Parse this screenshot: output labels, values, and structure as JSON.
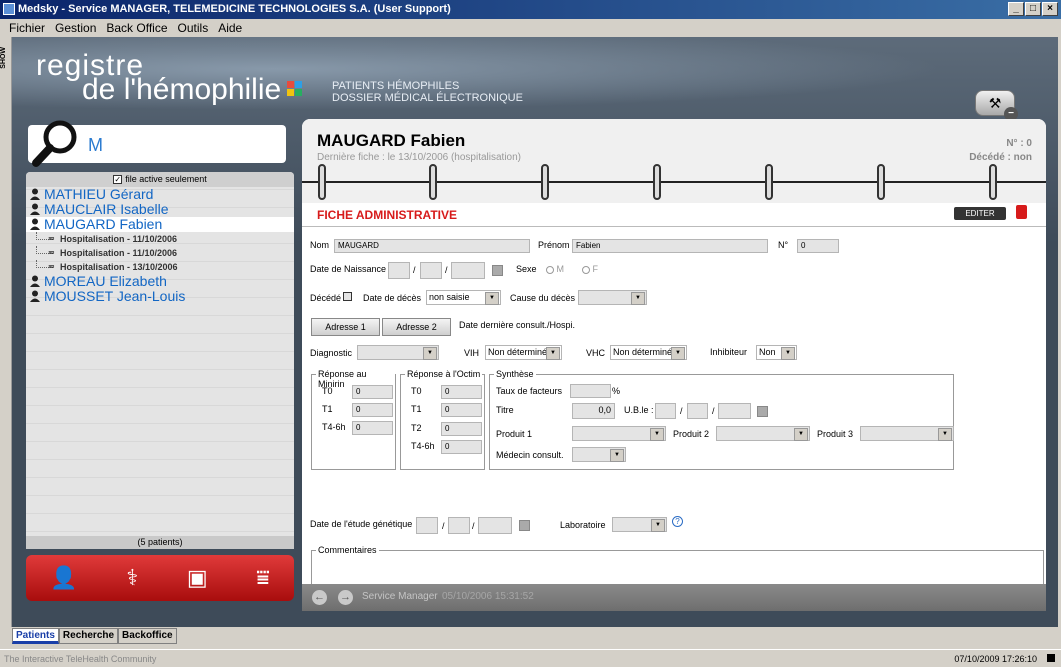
{
  "window": {
    "title": "Medsky - Service  MANAGER, TELEMEDICINE TECHNOLOGIES S.A. (User Support)"
  },
  "menu": [
    "Fichier",
    "Gestion",
    "Back Office",
    "Outils",
    "Aide"
  ],
  "sidebar_tab": "SHOW",
  "brand": {
    "line1": "registre",
    "line2": "de l'hémophilie",
    "subtitle1": "PATIENTS HÉMOPHILES",
    "subtitle2": "DOSSIER MÉDICAL ÉLECTRONIQUE"
  },
  "search": {
    "value": "M",
    "active_only_label": "file active seulement",
    "active_only_checked": true
  },
  "patients": [
    {
      "name": "MATHIEU Gérard"
    },
    {
      "name": "MAUCLAIR Isabelle"
    },
    {
      "name": "MAUGARD Fabien",
      "selected": true,
      "entries": [
        "Hospitalisation - 11/10/2006",
        "Hospitalisation - 11/10/2006",
        "Hospitalisation - 13/10/2006"
      ]
    },
    {
      "name": "MOREAU Elizabeth"
    },
    {
      "name": "MOUSSET Jean-Louis"
    }
  ],
  "patient_count": "(5 patients)",
  "record": {
    "name": "MAUGARD Fabien",
    "last_fiche": "Dernière fiche : le 13/10/2006 (hospitalisation)",
    "number": "N° : 0",
    "deceased": "Décédé : non",
    "section": "FICHE ADMINISTRATIVE",
    "edit_label": "EDITER"
  },
  "form": {
    "nom_label": "Nom",
    "nom": "MAUGARD",
    "prenom_label": "Prénom",
    "prenom": "Fabien",
    "num_label": "N°",
    "num": "0",
    "dob_label": "Date de Naissance",
    "sep": "/",
    "sexe_label": "Sexe",
    "sexe_m": "M",
    "sexe_f": "F",
    "decede_label": "Décédé",
    "date_deces_label": "Date de décès",
    "date_deces": "non saisie",
    "cause_label": "Cause du décès",
    "adresse1": "Adresse 1",
    "adresse2": "Adresse 2",
    "last_consult_label": "Date dernière consult./Hospi.",
    "diagnostic_label": "Diagnostic",
    "vih_label": "VIH",
    "vih": "Non déterminé",
    "vhc_label": "VHC",
    "vhc": "Non déterminé",
    "inhib_label": "Inhibiteur",
    "inhib": "Non",
    "minirin": {
      "title": "Réponse au Minirin",
      "rows": [
        {
          "label": "T0",
          "value": "0"
        },
        {
          "label": "T1",
          "value": "0"
        },
        {
          "label": "T4-6h",
          "value": "0"
        }
      ]
    },
    "octim": {
      "title": "Réponse à l'Octim",
      "rows": [
        {
          "label": "T0",
          "value": "0"
        },
        {
          "label": "T1",
          "value": "0"
        },
        {
          "label": "T2",
          "value": "0"
        },
        {
          "label": "T4-6h",
          "value": "0"
        }
      ]
    },
    "synthese": {
      "title": "Synthèse",
      "taux_label": "Taux de facteurs",
      "pct": "%",
      "titre_label": "Titre",
      "titre": "0,0",
      "ub_label": "U.B.le :",
      "p1_label": "Produit 1",
      "p2_label": "Produit 2",
      "p3_label": "Produit 3",
      "medecin_label": "Médecin consult."
    },
    "genetic_label": "Date de l'étude génétique",
    "labo_label": "Laboratoire",
    "comments_label": "Commentaires"
  },
  "footer": {
    "user": "Service Manager",
    "timestamp": "05/10/2006 15:31:52"
  },
  "bottom_tabs": [
    "Patients",
    "Recherche",
    "Backoffice"
  ],
  "status": {
    "left": "The Interactive TeleHealth Community",
    "right": "07/10/2009 17:26:10"
  },
  "colors": {
    "accent_red": "#d71b1b",
    "link_blue": "#1266c4"
  }
}
